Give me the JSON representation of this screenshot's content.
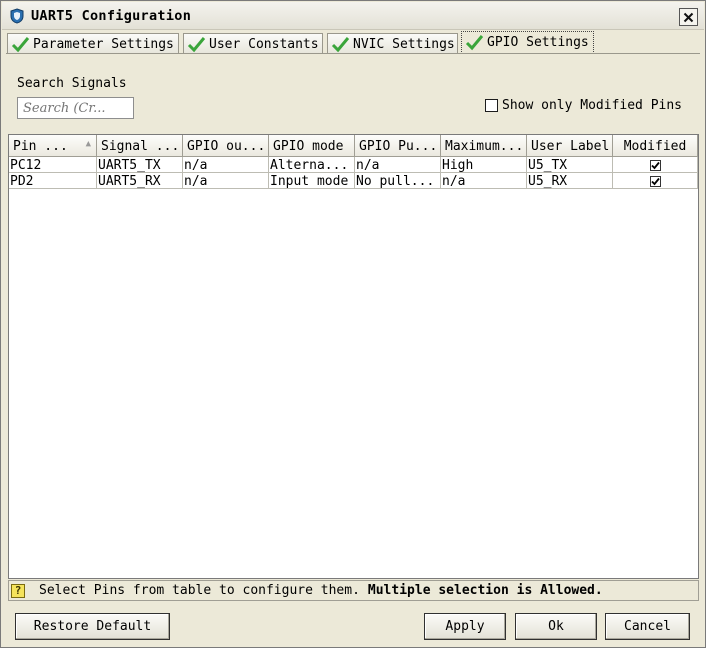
{
  "window": {
    "title": "UART5 Configuration"
  },
  "tabs": [
    {
      "label": "Parameter Settings",
      "active": false
    },
    {
      "label": "User Constants",
      "active": false
    },
    {
      "label": "NVIC Settings",
      "active": false
    },
    {
      "label": "GPIO Settings",
      "active": true
    }
  ],
  "search": {
    "label": "Search Signals",
    "placeholder": "Search (Cr..."
  },
  "filter": {
    "label": "Show only Modified Pins",
    "checked": false
  },
  "table": {
    "columns": [
      "Pin ...",
      "Signal ...",
      "GPIO ou...",
      "GPIO mode",
      "GPIO Pu...",
      "Maximum...",
      "User Label",
      "Modified"
    ],
    "rows": [
      {
        "pin": "PC12",
        "signal": "UART5_TX",
        "output": "n/a",
        "mode": "Alterna...",
        "pull": "n/a",
        "max_speed": "High",
        "label": "U5_TX",
        "modified": true
      },
      {
        "pin": "PD2",
        "signal": "UART5_RX",
        "output": "n/a",
        "mode": "Input mode",
        "pull": "No pull...",
        "max_speed": "n/a",
        "label": "U5_RX",
        "modified": true
      }
    ]
  },
  "status": {
    "text": "Select Pins from table to configure them.",
    "bold_text": "Multiple selection is Allowed."
  },
  "buttons": {
    "restore": "Restore Default",
    "apply": "Apply",
    "ok": "Ok",
    "cancel": "Cancel"
  },
  "colors": {
    "window_bg": "#ece9d8",
    "check_green": "#3aa53a",
    "help_icon": "#f5e35b"
  }
}
